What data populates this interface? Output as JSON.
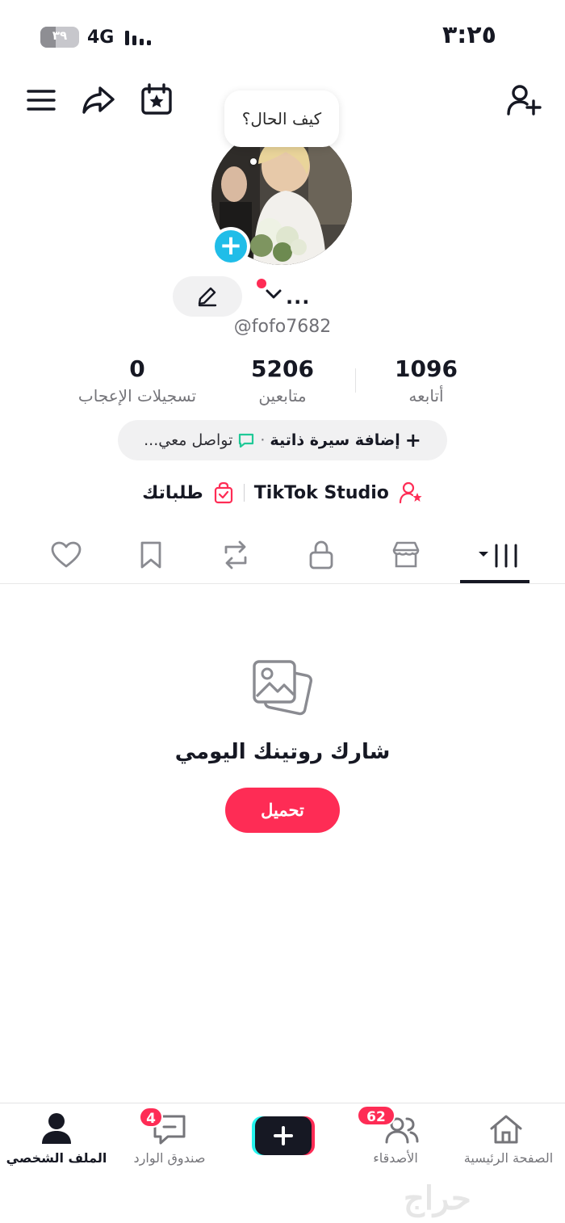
{
  "status_bar": {
    "time": "٣:٢٥",
    "battery": "٣٩",
    "battery_level": 0.39,
    "network": "4G"
  },
  "profile": {
    "bubble_text": "كيف الحال؟",
    "display_name": "...",
    "handle": "@fofo7682"
  },
  "stats": {
    "likes": {
      "value": "0",
      "label": "تسجيلات الإعجاب"
    },
    "followers": {
      "value": "5206",
      "label": "متابعين"
    },
    "following": {
      "value": "1096",
      "label": "أتابعه"
    }
  },
  "bio": {
    "add_bio": "إضافة سيرة ذاتية",
    "separator": "·",
    "contact": "تواصل معي..."
  },
  "links": {
    "studio": "TikTok Studio",
    "orders": "طلباتك"
  },
  "tabs": [
    "videos",
    "shop",
    "private",
    "reposts",
    "favorites",
    "liked"
  ],
  "empty_state": {
    "title": "شارك روتينك اليومي",
    "button": "تحميل"
  },
  "bottom_nav": {
    "home": "الصفحة الرئيسية",
    "friends": "الأصدقاء",
    "friends_badge": "62",
    "inbox": "صندوق الوارد",
    "inbox_badge": "4",
    "profile": "الملف الشخصي"
  },
  "watermark": "حراج",
  "colors": {
    "accent": "#fe2c55",
    "teal": "#20bde8",
    "text": "#161823",
    "muted": "#75757a"
  }
}
